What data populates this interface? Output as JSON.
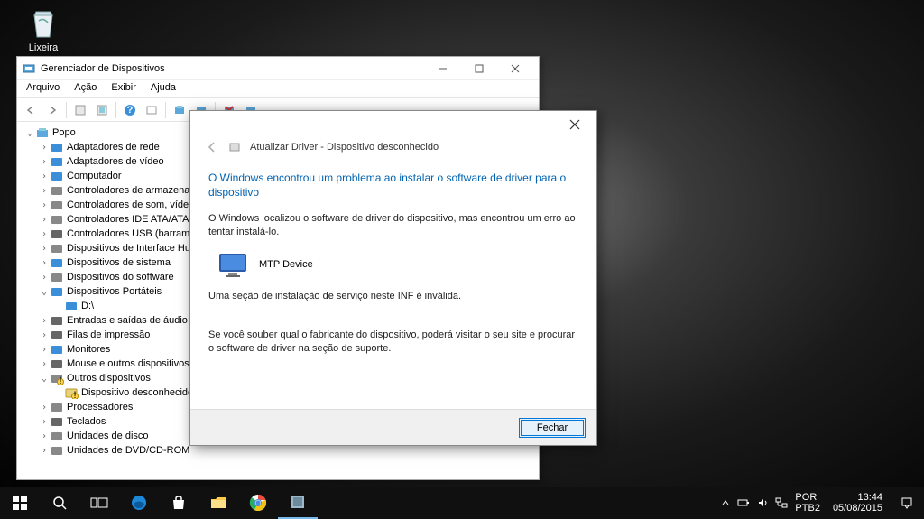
{
  "desktop": {
    "recycle_bin": "Lixeira"
  },
  "devmgr": {
    "title": "Gerenciador de Dispositivos",
    "menu": {
      "file": "Arquivo",
      "action": "Ação",
      "view": "Exibir",
      "help": "Ajuda"
    },
    "tree": {
      "root": "Popo",
      "nodes": [
        {
          "label": "Adaptadores de rede",
          "icon": "network-icon"
        },
        {
          "label": "Adaptadores de vídeo",
          "icon": "display-icon"
        },
        {
          "label": "Computador",
          "icon": "computer-icon"
        },
        {
          "label": "Controladores de armazenamento",
          "icon": "storage-icon"
        },
        {
          "label": "Controladores de som, vídeo e jogos",
          "icon": "sound-icon"
        },
        {
          "label": "Controladores IDE ATA/ATAPI",
          "icon": "ide-icon"
        },
        {
          "label": "Controladores USB (barramento serial universal)",
          "icon": "usb-icon"
        },
        {
          "label": "Dispositivos de Interface Humana",
          "icon": "hid-icon"
        },
        {
          "label": "Dispositivos de sistema",
          "icon": "system-icon"
        },
        {
          "label": "Dispositivos do software",
          "icon": "software-icon"
        }
      ],
      "portable": {
        "label": "Dispositivos Portáteis",
        "children": [
          {
            "label": "D:\\",
            "icon": "drive-icon"
          }
        ]
      },
      "nodes2": [
        {
          "label": "Entradas e saídas de áudio",
          "icon": "audio-icon"
        },
        {
          "label": "Filas de impressão",
          "icon": "print-icon"
        },
        {
          "label": "Monitores",
          "icon": "monitor-icon"
        },
        {
          "label": "Mouse e outros dispositivos apontadores",
          "icon": "mouse-icon"
        }
      ],
      "other": {
        "label": "Outros dispositivos",
        "children": [
          {
            "label": "Dispositivo desconhecido",
            "icon": "unknown-icon"
          }
        ]
      },
      "nodes3": [
        {
          "label": "Processadores",
          "icon": "cpu-icon"
        },
        {
          "label": "Teclados",
          "icon": "keyboard-icon"
        },
        {
          "label": "Unidades de disco",
          "icon": "disk-icon"
        },
        {
          "label": "Unidades de DVD/CD-ROM",
          "icon": "optical-icon"
        }
      ]
    }
  },
  "dlg": {
    "crumb_title": "Atualizar Driver - Dispositivo desconhecido",
    "heading": "O Windows encontrou um problema ao instalar o software de driver para o dispositivo",
    "p1": "O Windows localizou o software de driver do dispositivo, mas encontrou um erro ao tentar instalá-lo.",
    "device": "MTP Device",
    "p2": "Uma seção de instalação de serviço neste INF é inválida.",
    "p3": "Se você souber qual o fabricante do dispositivo, poderá visitar o seu site e procurar o software de driver na seção de suporte.",
    "close": "Fechar"
  },
  "taskbar": {
    "lang1": "POR",
    "lang2": "PTB2",
    "time": "13:44",
    "date": "05/08/2015"
  }
}
